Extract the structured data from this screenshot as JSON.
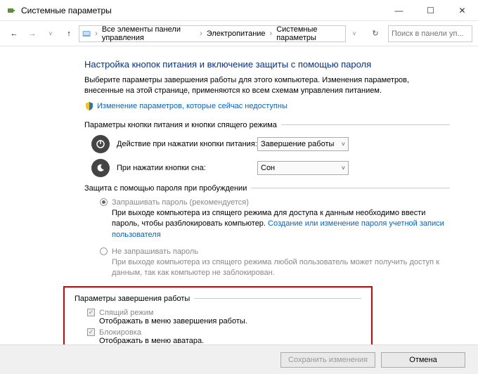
{
  "window": {
    "title": "Системные параметры"
  },
  "breadcrumb": {
    "root": "Все элементы панели управления",
    "mid": "Электропитание",
    "leaf": "Системные параметры"
  },
  "search": {
    "placeholder": "Поиск в панели уп..."
  },
  "heading": "Настройка кнопок питания и включение защиты с помощью пароля",
  "intro": "Выберите параметры завершения работы для этого компьютера. Изменения параметров, внесенные на этой странице, применяются ко всем схемам управления питанием.",
  "change_link": "Изменение параметров, которые сейчас недоступны",
  "s1": {
    "head": "Параметры кнопки питания и кнопки спящего режима",
    "power_label": "Действие при нажатии кнопки питания:",
    "power_value": "Завершение работы",
    "sleep_label": "При нажатии кнопки сна:",
    "sleep_value": "Сон"
  },
  "s2": {
    "head": "Защита с помощью пароля при пробуждении",
    "opt1_label": "Запрашивать пароль (рекомендуется)",
    "opt1_desc": "При выходе компьютера из спящего режима для доступа к данным необходимо ввести пароль, чтобы разблокировать компьютер. ",
    "opt1_link": "Создание или изменение пароля учетной записи пользователя",
    "opt2_label": "Не запрашивать пароль",
    "opt2_desc": "При выходе компьютера из спящего режима любой пользователь может получить доступ к данным, так как компьютер не заблокирован."
  },
  "s3": {
    "head": "Параметры завершения работы",
    "cb1_label": "Спящий режим",
    "cb1_desc": "Отображать в меню завершения работы.",
    "cb2_label": "Блокировка",
    "cb2_desc": "Отображать в меню аватара."
  },
  "footer": {
    "save": "Сохранить изменения",
    "cancel": "Отмена"
  }
}
